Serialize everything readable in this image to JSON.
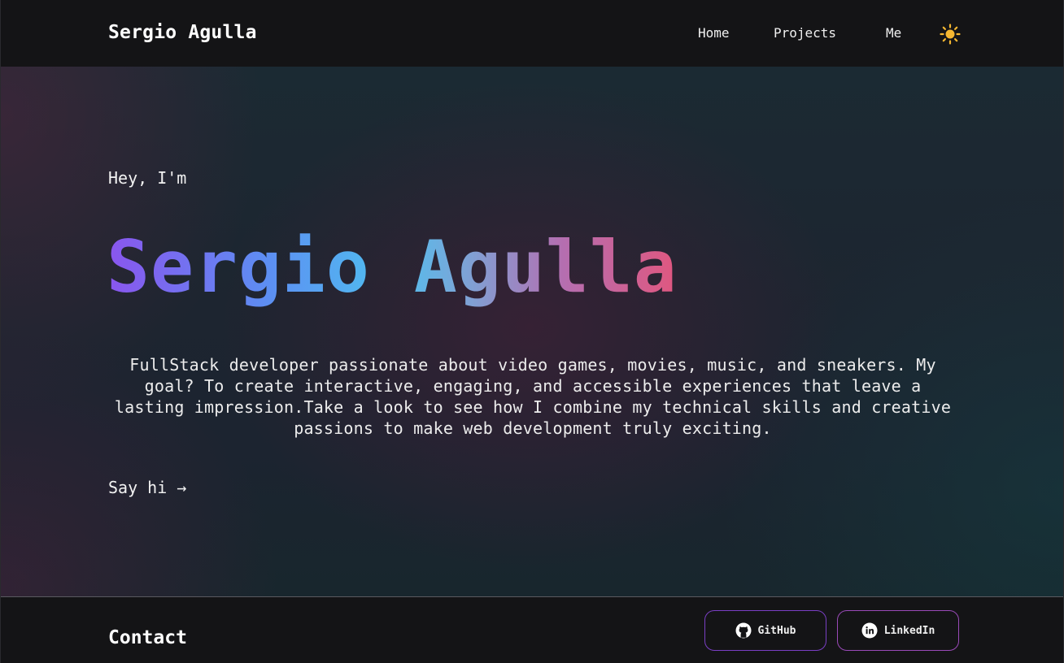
{
  "header": {
    "brand": "Sergio Agulla",
    "nav": [
      {
        "label": "Home"
      },
      {
        "label": "Projects"
      },
      {
        "label": "Me"
      }
    ],
    "theme_toggle_icon": "sun-icon",
    "theme_toggle_color": "#f5b731"
  },
  "hero": {
    "greeting": "Hey, I'm",
    "name": "Sergio Agulla",
    "name_gradient": [
      "#8a55ee",
      "#4fc0f0",
      "#e0577f"
    ],
    "bio": "FullStack developer passionate about video games, movies, music, and sneakers. My goal? To create interactive, engaging, and accessible experiences that leave a lasting impression.Take a look to see how I combine my technical skills and creative passions to make web development truly exciting.",
    "cta": "Say hi →"
  },
  "footer": {
    "title": "Contact",
    "buttons": [
      {
        "label": "GitHub",
        "icon": "github-icon"
      },
      {
        "label": "LinkedIn",
        "icon": "linkedin-icon"
      }
    ]
  }
}
